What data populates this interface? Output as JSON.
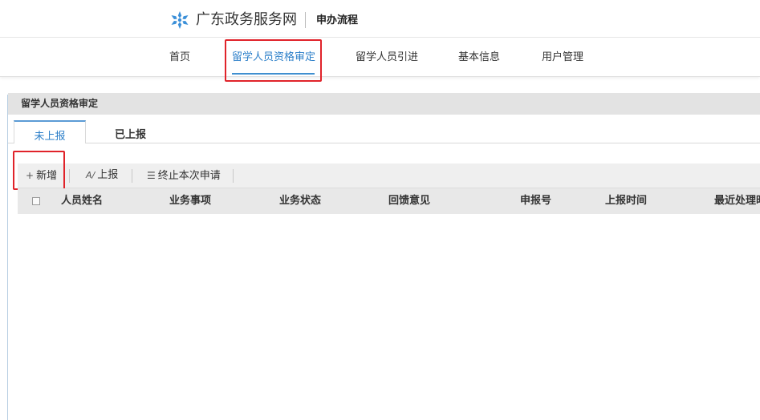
{
  "header": {
    "logo_icon": "snowflake-logo-icon",
    "site_title": "广东政务服务网",
    "process_title": "申办流程"
  },
  "nav": {
    "items": [
      {
        "label": "首页",
        "active": false
      },
      {
        "label": "留学人员资格审定",
        "active": true
      },
      {
        "label": "留学人员引进",
        "active": false
      },
      {
        "label": "基本信息",
        "active": false
      },
      {
        "label": "用户管理",
        "active": false
      }
    ]
  },
  "panel": {
    "title": "留学人员资格审定",
    "tabs": [
      {
        "label": "未上报",
        "active": true
      },
      {
        "label": "已上报",
        "active": false
      }
    ],
    "toolbar": {
      "add_label": "新增",
      "add_icon": "plus-icon",
      "report_label": "上报",
      "report_icon": "signature-icon",
      "terminate_label": "终止本次申请",
      "terminate_icon": "list-icon"
    },
    "table": {
      "columns": [
        "人员姓名",
        "业务事项",
        "业务状态",
        "回馈意见",
        "申报号",
        "上报时间",
        "最近处理时间"
      ],
      "rows": []
    }
  },
  "colors": {
    "accent": "#2c7fc9",
    "highlight": "#e0232a",
    "logo": "#3a8fd8"
  }
}
